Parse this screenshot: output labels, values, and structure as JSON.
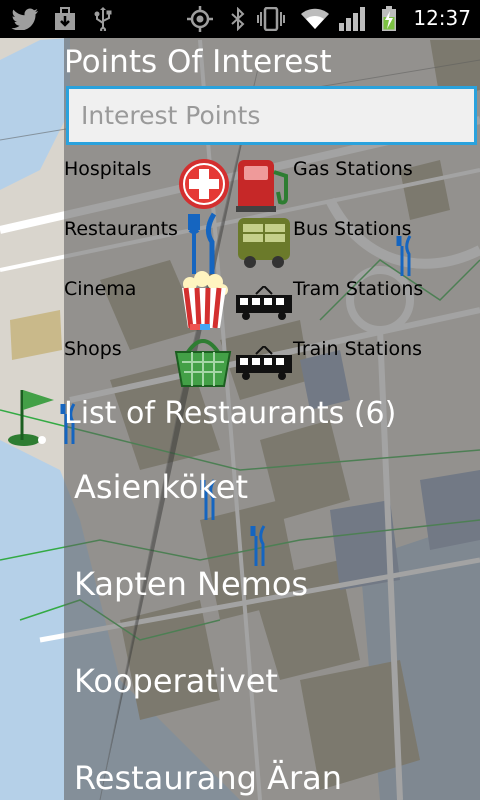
{
  "status_bar": {
    "time": "12:37",
    "left_icons": [
      "twitter-icon",
      "download-icon",
      "usb-icon"
    ],
    "right_icons": [
      "gps-icon",
      "bluetooth-icon",
      "vibrate-icon",
      "wifi-icon",
      "signal-icon",
      "battery-charging-icon"
    ]
  },
  "poi": {
    "title": "Points Of Interest",
    "search_placeholder": "Interest Points",
    "search_value": ""
  },
  "categories": {
    "hospitals": "Hospitals",
    "gas_stations": "Gas Stations",
    "restaurants": "Restaurants",
    "bus_stations": "Bus Stations",
    "cinema": "Cinema",
    "tram_stations": "Tram Stations",
    "shops": "Shops",
    "train_stations": "Train Stations"
  },
  "restaurants": {
    "header": "List of Restaurants (6)",
    "items": [
      "Asienköket",
      "Kapten Nemos",
      "Kooperativet",
      "Restaurang Äran"
    ]
  },
  "colors": {
    "accent": "#2aa2dd",
    "water": "#b5d0e8",
    "building": "#a39b80",
    "status_bar": "#000000"
  }
}
